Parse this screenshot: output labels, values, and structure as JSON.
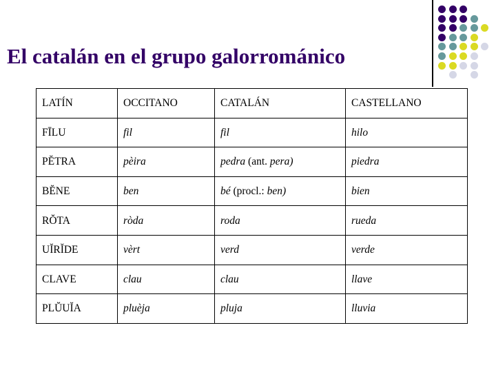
{
  "slide": {
    "title": "El catalán en el grupo galorrománico",
    "title_color": "#330066",
    "background_color": "#ffffff"
  },
  "decoration": {
    "name": "dot-grid",
    "rows": 8,
    "columns": 5,
    "palette": {
      "purple": "#330066",
      "teal": "#66999c",
      "yellow": "#dada23",
      "light": "#d5d7e6"
    },
    "grid": [
      [
        "purple",
        "purple",
        "purple",
        null,
        null
      ],
      [
        "purple",
        "purple",
        "purple",
        "teal",
        null
      ],
      [
        "purple",
        "purple",
        "teal",
        "teal",
        "yellow"
      ],
      [
        "purple",
        "teal",
        "teal",
        "yellow",
        null
      ],
      [
        "teal",
        "teal",
        "yellow",
        "yellow",
        "light"
      ],
      [
        "teal",
        "yellow",
        "yellow",
        "light",
        null
      ],
      [
        "yellow",
        "yellow",
        "light",
        "light",
        null
      ],
      [
        null,
        "light",
        null,
        "light",
        null
      ]
    ],
    "vertical_rule_color": "#000000"
  },
  "table": {
    "name": "latin-romance-cognates",
    "headers": [
      "LATÍN",
      "OCCITANO",
      "CATALÁN",
      "CASTELLANO"
    ],
    "rows": [
      {
        "latin": "FĪLU",
        "occitan": "fil",
        "catalan": "fil",
        "catalan_note": "",
        "catalan_note_italic": "",
        "spanish": "hilo"
      },
      {
        "latin": "PĔTRA",
        "occitan": "pèira",
        "catalan": "pedra",
        "catalan_note": " (ant. ",
        "catalan_note_italic": "pera)",
        "spanish": "piedra"
      },
      {
        "latin": "BĔNE",
        "occitan": "ben",
        "catalan": "bé",
        "catalan_note": " (procl.: ",
        "catalan_note_italic": "ben)",
        "spanish": "bien"
      },
      {
        "latin": "RŎTA",
        "occitan": "ròda",
        "catalan": "roda",
        "catalan_note": "",
        "catalan_note_italic": "",
        "spanish": "rueda"
      },
      {
        "latin": "UĬRĬDE",
        "occitan": "vèrt",
        "catalan": "verd",
        "catalan_note": "",
        "catalan_note_italic": "",
        "spanish": "verde"
      },
      {
        "latin": "CLAVE",
        "occitan": "clau",
        "catalan": "clau",
        "catalan_note": "",
        "catalan_note_italic": "",
        "spanish": "llave"
      },
      {
        "latin": "PLŬUĬA",
        "occitan": "pluèja",
        "catalan": "pluja",
        "catalan_note": "",
        "catalan_note_italic": "",
        "spanish": "lluvia"
      }
    ]
  }
}
